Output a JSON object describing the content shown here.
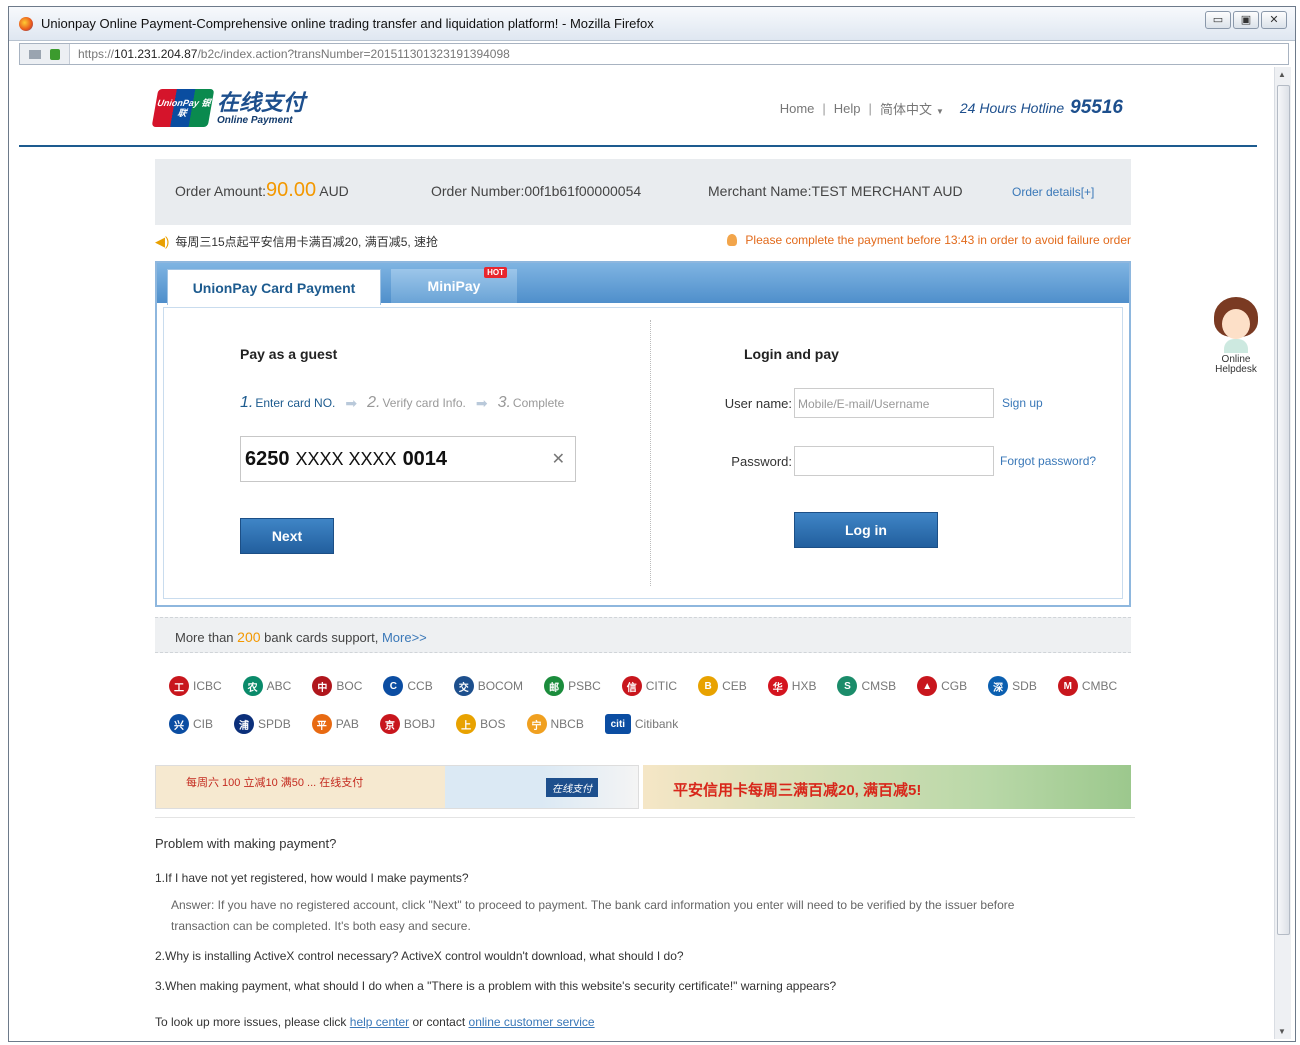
{
  "browser": {
    "title": "Unionpay Online Payment-Comprehensive online trading transfer and liquidation platform! - Mozilla Firefox",
    "url_prefix": "https://",
    "url_host": "101.231.204.87",
    "url_path": "/b2c/index.action?transNumber=201511301323191394098",
    "min": "▭",
    "max": "▣",
    "close": "✕"
  },
  "header": {
    "logo_mark": "UnionPay 银联",
    "logo_cn": "在线支付",
    "logo_en": "Online Payment",
    "nav_home": "Home",
    "nav_help": "Help",
    "nav_lang": "简体中文",
    "hotline_label": "24 Hours Hotline",
    "hotline_number": "95516"
  },
  "order": {
    "amount_label": "Order Amount:",
    "amount_value": "90.00",
    "currency": "AUD",
    "number_label": "Order Number:",
    "number_value": "00f1b61f00000054",
    "merchant_label": "Merchant Name:",
    "merchant_value": "TEST MERCHANT AUD",
    "details_link": "Order details[+]"
  },
  "notices": {
    "promo": "每周三15点起平安信用卡满百减20, 满百减5, 速抢",
    "deadline": "Please complete the payment before 13:43 in order to avoid failure order"
  },
  "tabs": {
    "card_payment": "UnionPay Card Payment",
    "minipay": "MiniPay",
    "hot_badge": "HOT"
  },
  "guest": {
    "title": "Pay as a guest",
    "step1_num": "1.",
    "step1": "Enter card NO.",
    "step2_num": "2.",
    "step2": "Verify card Info.",
    "step3_num": "3.",
    "step3": "Complete",
    "card_prefix": "6250",
    "card_mask": "XXXX XXXX",
    "card_suffix": "0014",
    "clear": "✕",
    "next_button": "Next"
  },
  "login": {
    "title": "Login and pay",
    "username_label": "User name:",
    "username_placeholder": "Mobile/E-mail/Username",
    "signup": "Sign up",
    "password_label": "Password:",
    "forgot": "Forgot password?",
    "login_button": "Log in"
  },
  "banks": {
    "support_prefix": "More than",
    "support_count": "200",
    "support_suffix": "bank cards support,",
    "more": "More>>",
    "list": [
      {
        "name": "ICBC",
        "color": "#c8161d",
        "glyph": "工"
      },
      {
        "name": "ABC",
        "color": "#0a8a6a",
        "glyph": "农"
      },
      {
        "name": "BOC",
        "color": "#b0161c",
        "glyph": "中"
      },
      {
        "name": "CCB",
        "color": "#0b4da2",
        "glyph": "C"
      },
      {
        "name": "BOCOM",
        "color": "#1d4f8d",
        "glyph": "交"
      },
      {
        "name": "PSBC",
        "color": "#1b8c3c",
        "glyph": "邮"
      },
      {
        "name": "CITIC",
        "color": "#c8161d",
        "glyph": "信"
      },
      {
        "name": "CEB",
        "color": "#e8a200",
        "glyph": "B"
      },
      {
        "name": "HXB",
        "color": "#d4141f",
        "glyph": "华"
      },
      {
        "name": "CMSB",
        "color": "#1b8c6a",
        "glyph": "S"
      },
      {
        "name": "CGB",
        "color": "#c8161d",
        "glyph": "▲"
      },
      {
        "name": "SDB",
        "color": "#0b5fb0",
        "glyph": "深"
      },
      {
        "name": "CMBC",
        "color": "#c8161d",
        "glyph": "M"
      },
      {
        "name": "CIB",
        "color": "#0b4da2",
        "glyph": "兴"
      },
      {
        "name": "SPDB",
        "color": "#0b2f7a",
        "glyph": "浦"
      },
      {
        "name": "PAB",
        "color": "#e86a12",
        "glyph": "平"
      },
      {
        "name": "BOBJ",
        "color": "#c8161d",
        "glyph": "京"
      },
      {
        "name": "BOS",
        "color": "#e8a200",
        "glyph": "上"
      },
      {
        "name": "NBCB",
        "color": "#f0a020",
        "glyph": "宁"
      },
      {
        "name": "Citibank",
        "color": "#0b4da2",
        "glyph": "citi"
      }
    ]
  },
  "ads": {
    "ad1_text": "每周六 100 立减10 满50 ... 在线支付",
    "ad1_logo": "在线支付",
    "ad2_text": "平安信用卡每周三满百减20, 满百减5!"
  },
  "faq": {
    "title": "Problem with making payment?",
    "q1": "1.If I have not yet registered, how would I make payments?",
    "a1": "Answer: If you have no registered account, click \"Next\" to proceed to payment. The bank card information you enter will need to be verified by the issuer before transaction can be completed. It's both easy and secure.",
    "q2": "2.Why is installing ActiveX control necessary? ActiveX control wouldn't download, what should I do?",
    "q3": "3.When making payment, what should I do when a \"There is a problem with this website's security certificate!\" warning appears?",
    "more_prefix": "To look up more issues, please click",
    "help_center": "help center",
    "or_contact": "or contact",
    "online_service": "online customer service"
  },
  "helpdesk": {
    "line1": "Online",
    "line2": "Helpdesk"
  }
}
